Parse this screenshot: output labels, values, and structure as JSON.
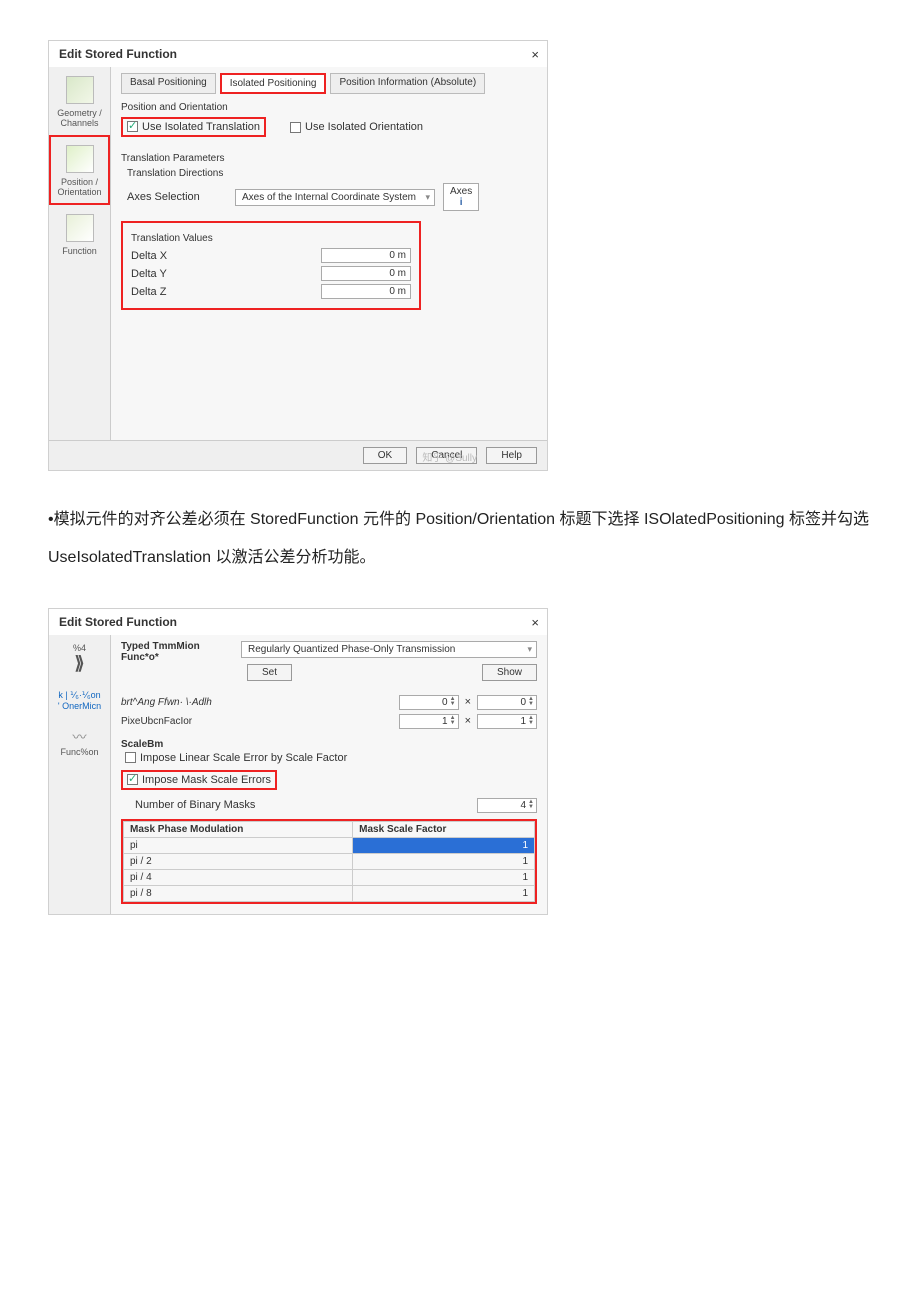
{
  "dialog1": {
    "title": "Edit Stored Function",
    "close": "×",
    "side": {
      "geom": "Geometry / Channels",
      "pos": "Position / Orientation",
      "func": "Function"
    },
    "tabs": {
      "basal": "Basal Positioning",
      "isolated": "Isolated Positioning",
      "info": "Position Information (Absolute)"
    },
    "group_pos": "Position and Orientation",
    "use_iso_trans": "Use Isolated Translation",
    "use_iso_orient": "Use Isolated Orientation",
    "trans_params": "Translation Parameters",
    "trans_dirs": "Translation Directions",
    "axes_sel": "Axes Selection",
    "axes_sel_val": "Axes of the Internal Coordinate System",
    "axes_btn": "Axes",
    "axes_info": "i",
    "trans_vals": "Translation Values",
    "dx": "Delta X",
    "dx_v": "0 m",
    "dy": "Delta Y",
    "dy_v": "0 m",
    "dz": "Delta Z",
    "dz_v": "0 m",
    "ok": "OK",
    "cancel": "Cancel",
    "help": "Help",
    "watermark": "知乎 @Sully"
  },
  "body_text": "•模拟元件的对齐公差必须在 StoredFunction 元件的 Position/Orientation 标题下选择 ISOlatedPositioning 标签并勾选 UseIsolatedTranslation 以激活公差分析功能。",
  "dialog2": {
    "title": "Edit Stored Function",
    "close": "×",
    "side": {
      "t1a": "%4",
      "t1b": "⟫",
      "t2": "k  | ⅟₆·⅟₆on\n' OnerMicn",
      "t3": "Func%on"
    },
    "typed": "Typed TmmMion Func*o*",
    "trans_type": "Regularly Quantized Phase-Only Transmission",
    "set": "Set",
    "show": "Show",
    "bra": "brt^Ang Ffwn· \\·Adlh",
    "pix": "PixeUbcnFacIor",
    "v0": "0",
    "v1": "1",
    "times": "×",
    "scale": "ScaleBm",
    "linerr": "Impose Linear Scale Error by Scale Factor",
    "maskerr": "Impose Mask Scale Errors",
    "nmasks": "Number of Binary Masks",
    "nmasks_v": "4",
    "th1": "Mask Phase Modulation",
    "th2": "Mask Scale Factor",
    "rows": [
      {
        "p": "pi",
        "f": "1"
      },
      {
        "p": "pi / 2",
        "f": "1"
      },
      {
        "p": "pi / 4",
        "f": "1"
      },
      {
        "p": "pi / 8",
        "f": "1"
      }
    ]
  }
}
